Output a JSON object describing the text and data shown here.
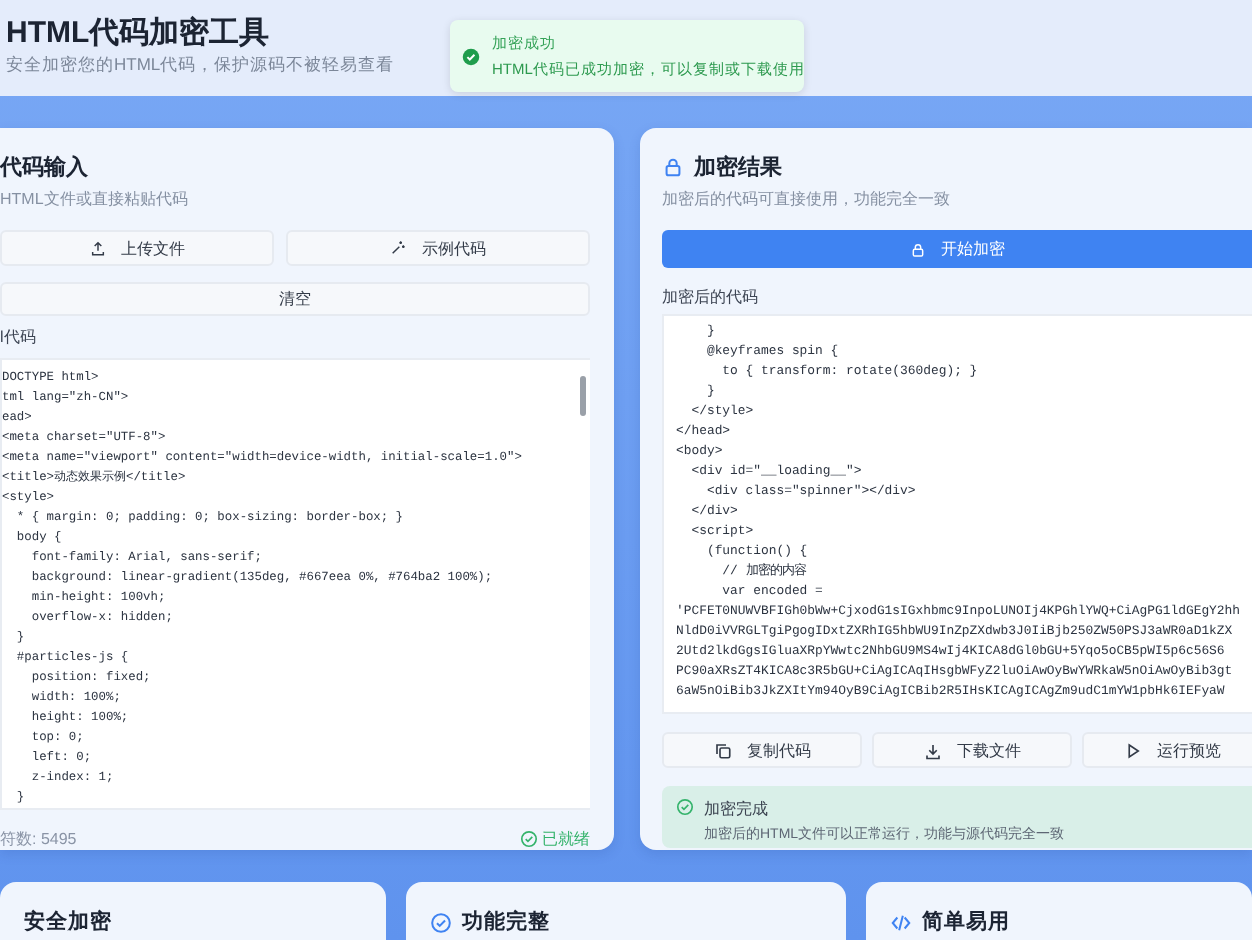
{
  "header": {
    "title": "HTML代码加密工具",
    "subtitle": "安全加密您的HTML代码，保护源码不被轻易查看"
  },
  "toast": {
    "title": "加密成功",
    "message": "HTML代码已成功加密，可以复制或下载使用"
  },
  "input_panel": {
    "title": "代码输入",
    "subtitle": "HTML文件或直接粘贴代码",
    "buttons": [
      {
        "label": "上传文件",
        "kind": "upload"
      },
      {
        "label": "示例代码",
        "kind": "magic"
      }
    ],
    "clear_button": "清空",
    "code_label": "l代码",
    "code_lines": [
      "DOCTYPE html>",
      "tml lang=\"zh-CN\">",
      "ead>",
      "<meta charset=\"UTF-8\">",
      "<meta name=\"viewport\" content=\"width=device-width, initial-scale=1.0\">",
      "<title>动态效果示例</title>",
      "<style>",
      "  * { margin: 0; padding: 0; box-sizing: border-box; }",
      "  body {",
      "    font-family: Arial, sans-serif;",
      "    background: linear-gradient(135deg, #667eea 0%, #764ba2 100%);",
      "    min-height: 100vh;",
      "    overflow-x: hidden;",
      "  }",
      "  #particles-js {",
      "    position: fixed;",
      "    width: 100%;",
      "    height: 100%;",
      "    top: 0;",
      "    left: 0;",
      "    z-index: 1;",
      "  }"
    ],
    "char_count": "符数: 5495",
    "status": "已就绪"
  },
  "output_panel": {
    "title": "加密结果",
    "subtitle": "加密后的代码可直接使用，功能完全一致",
    "encrypt_button": "开始加密",
    "code_label": "加密后的代码",
    "code_lines": [
      "    }",
      "    @keyframes spin {",
      "      to { transform: rotate(360deg); }",
      "    }",
      "  </style>",
      "</head>",
      "<body>",
      "  <div id=\"__loading__\">",
      "    <div class=\"spinner\"></div>",
      "  </div>",
      "  <script>",
      "    (function() {",
      "      // 加密的内容",
      "      var encoded =",
      "'PCFET0NUWVBFIGh0bWw+CjxodG1sIGxhbmc9InpoLUNOIj4KPGhlYWQ+CiAgPG1ldGEgY2hh",
      "NldD0iVVRGLTgiPgogIDxtZXRhIG5hbWU9InZpZXdwb3J0IiBjb250ZW50PSJ3aWR0aD1kZX",
      "2Utd2lkdGgsIGluaXRpYWwtc2NhbGU9MS4wIj4KICA8dGl0bGU+5Yqo5oCB5pWI5p6c56S6",
      "PC90aXRsZT4KICA8c3R5bGU+CiAgICAqIHsgbWFyZ2luOiAwOyBwYWRkaW5nOiAwOyBib3gt",
      "6aW5nOiBib3JkZXItYm94OyB9CiAgICBib2R5IHsKICAgICAgZm9udC1mYW1pbHk6IEFyaW"
    ],
    "actions": [
      {
        "label": "复制代码",
        "kind": "copy"
      },
      {
        "label": "下载文件",
        "kind": "download"
      },
      {
        "label": "运行预览",
        "kind": "play"
      }
    ],
    "notice": {
      "title": "加密完成",
      "message": "加密后的HTML文件可以正常运行，功能与源代码完全一致"
    }
  },
  "features": [
    {
      "title": "安全加密",
      "kind": "none"
    },
    {
      "title": "功能完整",
      "kind": "check"
    },
    {
      "title": "简单易用",
      "kind": "code"
    }
  ]
}
